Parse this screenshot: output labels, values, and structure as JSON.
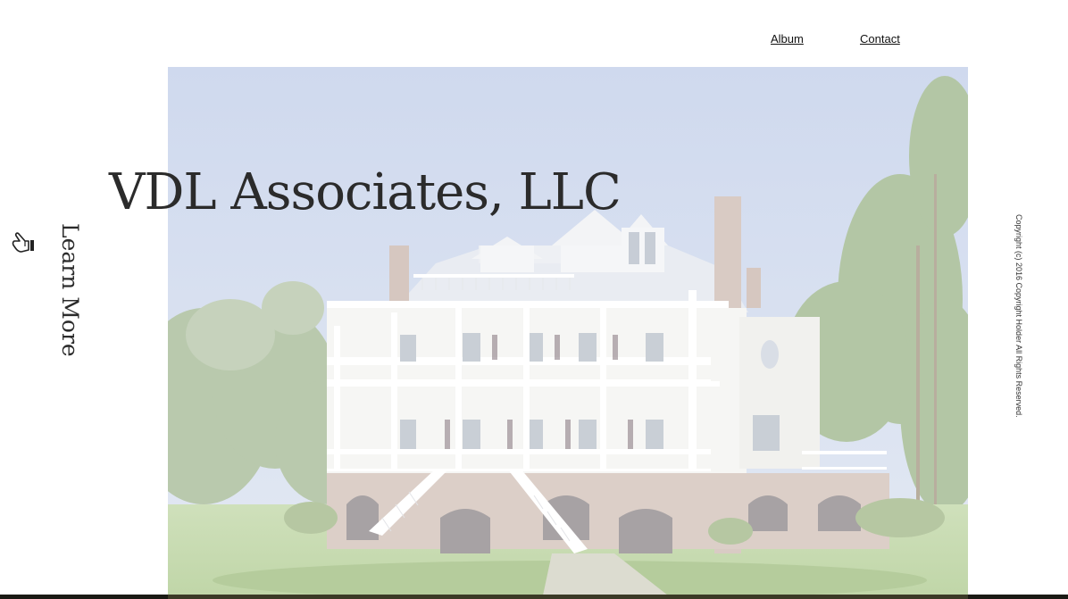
{
  "nav": {
    "album_label": "Album",
    "contact_label": "Contact"
  },
  "hero": {
    "title": "VDL Associates, LLC",
    "image_subject": "three-story white plantation-style house with porches"
  },
  "cta": {
    "learn_more_label": "Learn More",
    "icon": "pointing-hand-icon"
  },
  "footer": {
    "copyright": "Copyright (c) 2016 Copyright Holder All Rights Reserved."
  },
  "colors": {
    "background": "#ffffff",
    "title_text": "#2b2b2b",
    "link_text": "#111111",
    "sky": "#d3dcee",
    "lawn": "#c7dcb0"
  }
}
